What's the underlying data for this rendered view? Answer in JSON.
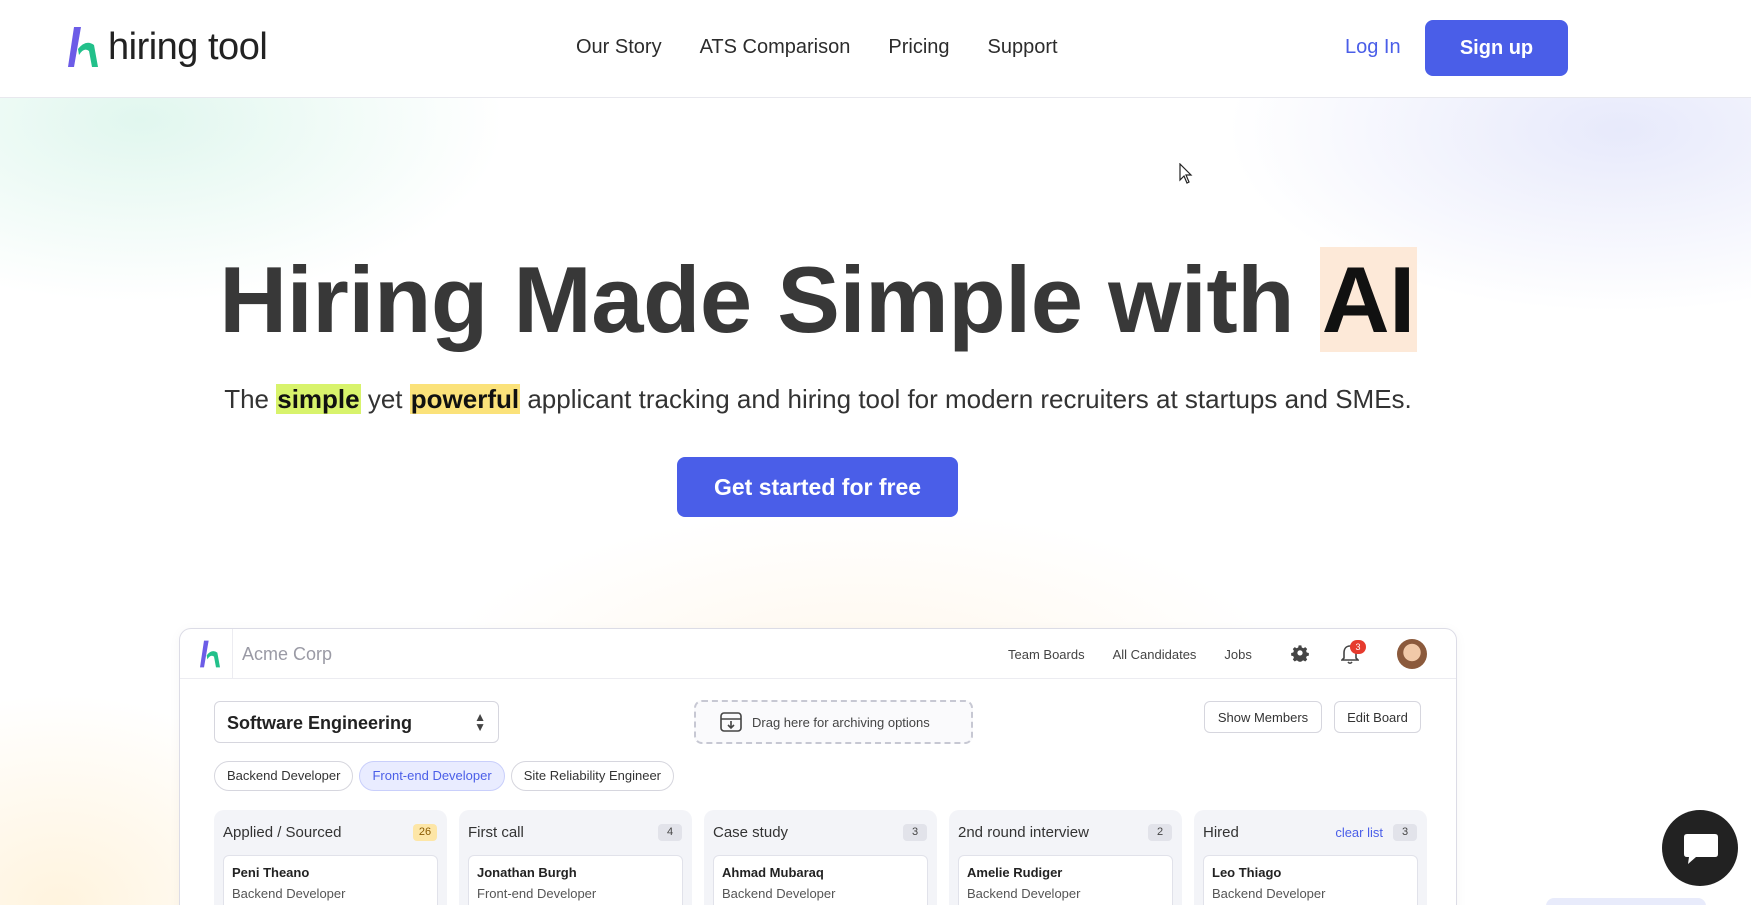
{
  "header": {
    "logo_text": "hiring tool",
    "nav": [
      "Our Story",
      "ATS Comparison",
      "Pricing",
      "Support"
    ],
    "login": "Log In",
    "signup": "Sign up"
  },
  "hero": {
    "title_main": "Hiring Made Simple with ",
    "title_highlight": "AI",
    "subtitle_pre": "The ",
    "subtitle_hl1": "simple",
    "subtitle_mid": " yet ",
    "subtitle_hl2": "powerful",
    "subtitle_post": " applicant tracking and hiring tool for modern recruiters at startups and SMEs.",
    "cta": "Get started for free"
  },
  "app": {
    "org": "Acme Corp",
    "nav": [
      "Team Boards",
      "All Candidates",
      "Jobs"
    ],
    "notifications": "3",
    "board": "Software Engineering",
    "drag_hint": "Drag here for archiving options",
    "show_members": "Show Members",
    "edit_board": "Edit Board",
    "tags": [
      {
        "label": "Backend Developer",
        "active": false
      },
      {
        "label": "Front-end Developer",
        "active": true
      },
      {
        "label": "Site Reliability Engineer",
        "active": false
      }
    ],
    "columns": [
      {
        "title": "Applied / Sourced",
        "count": "26",
        "card_name": "Peni Theano",
        "card_role": "Backend Developer"
      },
      {
        "title": "First call",
        "count": "4",
        "card_name": "Jonathan Burgh",
        "card_role": "Front-end Developer"
      },
      {
        "title": "Case study",
        "count": "3",
        "card_name": "Ahmad Mubaraq",
        "card_role": "Backend Developer"
      },
      {
        "title": "2nd round interview",
        "count": "2",
        "card_name": "Amelie Rudiger",
        "card_role": "Backend Developer"
      },
      {
        "title": "Hired",
        "count": "3",
        "clear": "clear list",
        "card_name": "Leo Thiago",
        "card_role": "Backend Developer"
      }
    ]
  },
  "colors": {
    "accent": "#4a5ee8",
    "highlight_ai": "#fde9d8",
    "highlight_simple": "#d8f36c",
    "highlight_powerful": "#fbe27a"
  }
}
